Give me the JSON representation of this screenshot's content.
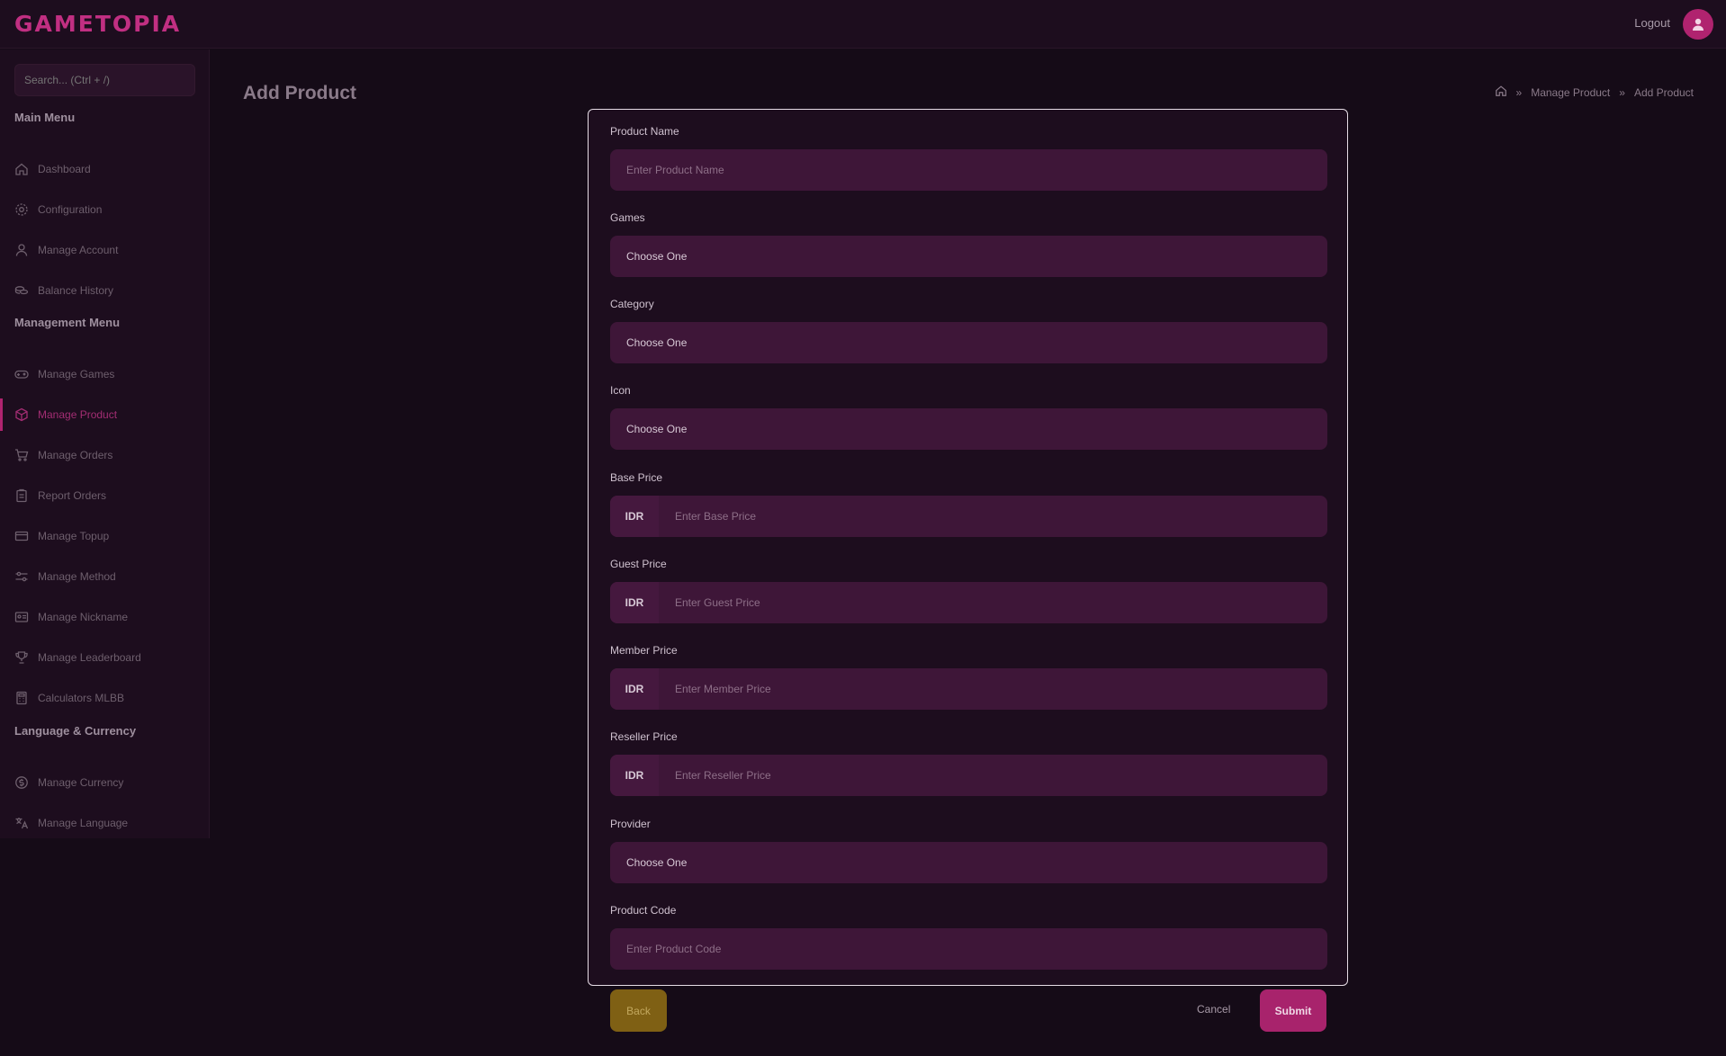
{
  "app": {
    "logo": "GAMETOPIA",
    "logout_label": "Logout"
  },
  "search": {
    "placeholder": "Search... (Ctrl + /)"
  },
  "sidebar": {
    "main_menu_title": "Main Menu",
    "main_items": [
      {
        "label": "Dashboard",
        "icon": "home-icon"
      },
      {
        "label": "Configuration",
        "icon": "gear-icon"
      },
      {
        "label": "Manage Account",
        "icon": "user-icon"
      },
      {
        "label": "Balance History",
        "icon": "coins-icon"
      }
    ],
    "management_title": "Management Menu",
    "management_items": [
      {
        "label": "Manage Games",
        "icon": "gamepad-icon"
      },
      {
        "label": "Manage Product",
        "icon": "box-icon"
      },
      {
        "label": "Manage Orders",
        "icon": "cart-icon"
      },
      {
        "label": "Report Orders",
        "icon": "clipboard-icon"
      },
      {
        "label": "Manage Topup",
        "icon": "card-icon"
      },
      {
        "label": "Manage Method",
        "icon": "sliders-icon"
      },
      {
        "label": "Manage Nickname",
        "icon": "id-card-icon"
      },
      {
        "label": "Manage Leaderboard",
        "icon": "trophy-icon"
      },
      {
        "label": "Calculators MLBB",
        "icon": "calculator-icon"
      }
    ],
    "lang_title": "Language & Currency",
    "lang_items": [
      {
        "label": "Manage Currency",
        "icon": "currency-icon"
      },
      {
        "label": "Manage Language",
        "icon": "translate-icon"
      }
    ],
    "active_item": "Manage Product"
  },
  "page": {
    "title": "Add Product",
    "breadcrumb": [
      "Manage Product",
      "Add Product"
    ]
  },
  "form": {
    "product_name": {
      "label": "Product Name",
      "placeholder": "Enter Product Name"
    },
    "games": {
      "label": "Games",
      "value": "Choose One"
    },
    "category": {
      "label": "Category",
      "value": "Choose One"
    },
    "icon": {
      "label": "Icon",
      "value": "Choose One"
    },
    "base_price": {
      "label": "Base Price",
      "prefix": "IDR",
      "placeholder": "Enter Base Price"
    },
    "guest_price": {
      "label": "Guest Price",
      "prefix": "IDR",
      "placeholder": "Enter Guest Price"
    },
    "member_price": {
      "label": "Member Price",
      "prefix": "IDR",
      "placeholder": "Enter Member Price"
    },
    "reseller_price": {
      "label": "Reseller Price",
      "prefix": "IDR",
      "placeholder": "Enter Reseller Price"
    },
    "provider": {
      "label": "Provider",
      "value": "Choose One"
    },
    "product_code": {
      "label": "Product Code",
      "placeholder": "Enter Product Code"
    }
  },
  "buttons": {
    "back": "Back",
    "cancel": "Cancel",
    "submit": "Submit"
  },
  "colors": {
    "accent": "#b0236f",
    "back_button": "#7f6014",
    "field_bg": "#3e1638"
  }
}
